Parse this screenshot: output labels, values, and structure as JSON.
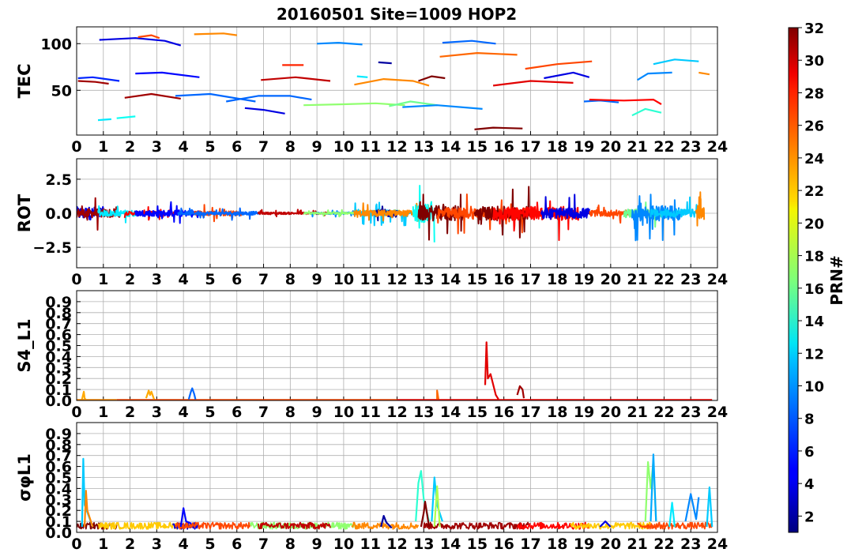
{
  "title": "20160501 Site=1009 HOP2",
  "colorbar": {
    "label": "PRN#",
    "min": 1,
    "max": 32,
    "ticks": [
      2,
      4,
      6,
      8,
      10,
      12,
      14,
      16,
      18,
      20,
      22,
      24,
      26,
      28,
      30,
      32
    ],
    "colormap": "jet"
  },
  "chart_data": [
    {
      "type": "line",
      "ylabel": "TEC",
      "xlim": [
        0,
        24
      ],
      "ylim": [
        2,
        118
      ],
      "xticks": [
        0,
        1,
        2,
        3,
        4,
        5,
        6,
        7,
        8,
        9,
        10,
        11,
        12,
        13,
        14,
        15,
        16,
        17,
        18,
        19,
        20,
        21,
        22,
        23,
        24
      ],
      "yticks": [
        50,
        100
      ],
      "ytick_labels": [
        "50",
        "100"
      ],
      "grid": true,
      "series": [
        {
          "prn": 6,
          "x": [
            0.05,
            0.6,
            1.6
          ],
          "y": [
            63,
            64,
            60
          ]
        },
        {
          "prn": 31,
          "x": [
            0.05,
            0.7,
            1.2
          ],
          "y": [
            60,
            59,
            57
          ]
        },
        {
          "prn": 12,
          "x": [
            0.8,
            1.3
          ],
          "y": [
            18,
            19
          ]
        },
        {
          "prn": 13,
          "x": [
            1.5,
            2.2
          ],
          "y": [
            20,
            22
          ]
        },
        {
          "prn": 4,
          "x": [
            0.85,
            2.2,
            3.3,
            3.9
          ],
          "y": [
            104,
            106,
            103,
            98
          ]
        },
        {
          "prn": 26,
          "x": [
            2.3,
            2.8,
            3.1
          ],
          "y": [
            107,
            109,
            106
          ]
        },
        {
          "prn": 5,
          "x": [
            2.2,
            3.2,
            4.6
          ],
          "y": [
            68,
            69,
            64
          ]
        },
        {
          "prn": 31,
          "x": [
            1.8,
            2.8,
            3.9
          ],
          "y": [
            42,
            46,
            41
          ]
        },
        {
          "prn": 24,
          "x": [
            4.4,
            5.5,
            6.0
          ],
          "y": [
            110,
            111,
            109
          ]
        },
        {
          "prn": 8,
          "x": [
            3.7,
            5.0,
            6.7
          ],
          "y": [
            44,
            46,
            38
          ]
        },
        {
          "prn": 8,
          "x": [
            5.6,
            6.8,
            8.0,
            8.8
          ],
          "y": [
            38,
            44,
            44,
            40
          ]
        },
        {
          "prn": 4,
          "x": [
            6.3,
            7.0,
            7.8
          ],
          "y": [
            31,
            29,
            25
          ]
        },
        {
          "prn": 30,
          "x": [
            6.9,
            8.2,
            9.5
          ],
          "y": [
            61,
            64,
            60
          ]
        },
        {
          "prn": 27,
          "x": [
            7.7,
            8.5
          ],
          "y": [
            77,
            77
          ]
        },
        {
          "prn": 9,
          "x": [
            9.0,
            9.8,
            10.7
          ],
          "y": [
            100,
            101,
            99
          ]
        },
        {
          "prn": 17,
          "x": [
            8.5,
            10.0,
            11.2,
            12.3
          ],
          "y": [
            34,
            35,
            36,
            34
          ]
        },
        {
          "prn": 16,
          "x": [
            11.7,
            12.5,
            13.5
          ],
          "y": [
            33,
            38,
            34
          ]
        },
        {
          "prn": 12,
          "x": [
            10.5,
            10.9
          ],
          "y": [
            65,
            64
          ]
        },
        {
          "prn": 2,
          "x": [
            11.3,
            11.8
          ],
          "y": [
            80,
            79
          ]
        },
        {
          "prn": 24,
          "x": [
            10.4,
            11.5,
            12.6,
            13.2
          ],
          "y": [
            56,
            62,
            60,
            55
          ]
        },
        {
          "prn": 32,
          "x": [
            12.8,
            13.3,
            13.8
          ],
          "y": [
            60,
            65,
            63
          ]
        },
        {
          "prn": 9,
          "x": [
            12.2,
            13.5,
            15.2
          ],
          "y": [
            32,
            34,
            30
          ]
        },
        {
          "prn": 8,
          "x": [
            13.7,
            14.8,
            15.7
          ],
          "y": [
            101,
            103,
            100
          ]
        },
        {
          "prn": 25,
          "x": [
            13.6,
            15.0,
            16.5
          ],
          "y": [
            86,
            90,
            88
          ]
        },
        {
          "prn": 32,
          "x": [
            14.9,
            15.6,
            16.7
          ],
          "y": [
            8,
            10,
            9
          ]
        },
        {
          "prn": 29,
          "x": [
            15.6,
            17.0,
            18.6
          ],
          "y": [
            55,
            60,
            58
          ]
        },
        {
          "prn": 4,
          "x": [
            17.5,
            18.6,
            19.2
          ],
          "y": [
            63,
            69,
            64
          ]
        },
        {
          "prn": 26,
          "x": [
            16.8,
            18.0,
            19.3
          ],
          "y": [
            73,
            78,
            81
          ]
        },
        {
          "prn": 8,
          "x": [
            19.0,
            19.6,
            20.3
          ],
          "y": [
            38,
            39,
            37
          ]
        },
        {
          "prn": 28,
          "x": [
            19.2,
            20.5,
            21.6,
            21.9
          ],
          "y": [
            40,
            39,
            40,
            35
          ]
        },
        {
          "prn": 14,
          "x": [
            20.8,
            21.3,
            21.9
          ],
          "y": [
            23,
            30,
            26
          ]
        },
        {
          "prn": 9,
          "x": [
            21.0,
            21.4,
            22.3
          ],
          "y": [
            61,
            68,
            69
          ]
        },
        {
          "prn": 11,
          "x": [
            21.6,
            22.4,
            23.3
          ],
          "y": [
            78,
            83,
            81
          ]
        },
        {
          "prn": 24,
          "x": [
            23.3,
            23.7
          ],
          "y": [
            69,
            67
          ]
        }
      ]
    },
    {
      "type": "line",
      "ylabel": "ROT",
      "xlim": [
        0,
        24
      ],
      "ylim": [
        -4,
        4
      ],
      "xticks": [
        0,
        1,
        2,
        3,
        4,
        5,
        6,
        7,
        8,
        9,
        10,
        11,
        12,
        13,
        14,
        15,
        16,
        17,
        18,
        19,
        20,
        21,
        22,
        23,
        24
      ],
      "yticks": [
        -2.5,
        0.0,
        2.5
      ],
      "ytick_labels": [
        "−2.5",
        "0.0",
        "2.5"
      ],
      "grid": true,
      "segments": [
        {
          "prn": 4,
          "start": 0.0,
          "end": 1.0,
          "amp": 1.9
        },
        {
          "prn": 31,
          "start": 0.0,
          "end": 1.6,
          "amp": 1.3
        },
        {
          "prn": 12,
          "start": 0.8,
          "end": 2.2,
          "amp": 0.9
        },
        {
          "prn": 28,
          "start": 1.8,
          "end": 3.9,
          "amp": 0.5
        },
        {
          "prn": 5,
          "start": 2.2,
          "end": 4.6,
          "amp": 0.9
        },
        {
          "prn": 26,
          "start": 4.4,
          "end": 6.2,
          "amp": 0.7
        },
        {
          "prn": 8,
          "start": 3.8,
          "end": 6.8,
          "amp": 0.5
        },
        {
          "prn": 30,
          "start": 6.8,
          "end": 9.5,
          "amp": 0.3
        },
        {
          "prn": 9,
          "start": 8.8,
          "end": 10.7,
          "amp": 0.3
        },
        {
          "prn": 17,
          "start": 8.5,
          "end": 12.2,
          "amp": 0.25
        },
        {
          "prn": 11,
          "start": 10.4,
          "end": 12.5,
          "amp": 0.9
        },
        {
          "prn": 2,
          "start": 11.2,
          "end": 12.0,
          "amp": 1.1
        },
        {
          "prn": 24,
          "start": 10.4,
          "end": 13.2,
          "amp": 0.9
        },
        {
          "prn": 13,
          "start": 12.6,
          "end": 13.4,
          "amp": 2.8
        },
        {
          "prn": 32,
          "start": 12.8,
          "end": 14.5,
          "amp": 2.2
        },
        {
          "prn": 26,
          "start": 13.5,
          "end": 16.8,
          "amp": 1.6
        },
        {
          "prn": 32,
          "start": 14.9,
          "end": 17.0,
          "amp": 2.0
        },
        {
          "prn": 28,
          "start": 15.6,
          "end": 18.8,
          "amp": 2.0
        },
        {
          "prn": 4,
          "start": 17.4,
          "end": 19.2,
          "amp": 1.5
        },
        {
          "prn": 26,
          "start": 19.2,
          "end": 21.8,
          "amp": 0.9
        },
        {
          "prn": 16,
          "start": 20.5,
          "end": 22.0,
          "amp": 1.3
        },
        {
          "prn": 9,
          "start": 20.8,
          "end": 22.6,
          "amp": 2.2
        },
        {
          "prn": 11,
          "start": 21.5,
          "end": 23.3,
          "amp": 1.2
        },
        {
          "prn": 24,
          "start": 23.2,
          "end": 23.5,
          "amp": 1.6
        }
      ]
    },
    {
      "type": "line",
      "ylabel": "S4_L1",
      "xlim": [
        0,
        24
      ],
      "ylim": [
        0,
        1
      ],
      "xticks": [
        0,
        1,
        2,
        3,
        4,
        5,
        6,
        7,
        8,
        9,
        10,
        11,
        12,
        13,
        14,
        15,
        16,
        17,
        18,
        19,
        20,
        21,
        22,
        23,
        24
      ],
      "yticks": [
        0.0,
        0.1,
        0.2,
        0.3,
        0.4,
        0.5,
        0.6,
        0.7,
        0.8,
        0.9
      ],
      "ytick_labels": [
        "0.0",
        "0.1",
        "0.2",
        "0.3",
        "0.4",
        "0.5",
        "0.6",
        "0.7",
        "0.8",
        "0.9"
      ],
      "grid": true,
      "baseline_series": [
        {
          "prn": 24,
          "start": 0.0,
          "end": 1.5
        },
        {
          "prn": 26,
          "start": 1.5,
          "end": 12.0
        },
        {
          "prn": 28,
          "start": 12.0,
          "end": 23.8
        }
      ],
      "series": [
        {
          "prn": 23,
          "x": [
            0.2,
            0.27,
            0.3,
            0.33
          ],
          "y": [
            0.01,
            0.08,
            0.02,
            0.01
          ]
        },
        {
          "prn": 23,
          "x": [
            2.6,
            2.7,
            2.75,
            2.8,
            2.9
          ],
          "y": [
            0.02,
            0.09,
            0.05,
            0.08,
            0.01
          ]
        },
        {
          "prn": 8,
          "x": [
            4.2,
            4.28,
            4.33,
            4.4,
            4.45
          ],
          "y": [
            0.01,
            0.08,
            0.11,
            0.06,
            0.01
          ]
        },
        {
          "prn": 25,
          "x": [
            13.5,
            13.5,
            13.55
          ],
          "y": [
            0.01,
            0.09,
            0.01
          ]
        },
        {
          "prn": 29,
          "x": [
            15.3,
            15.35,
            15.4,
            15.5,
            15.7,
            15.8
          ],
          "y": [
            0.14,
            0.53,
            0.2,
            0.24,
            0.05,
            0.01
          ]
        },
        {
          "prn": 31,
          "x": [
            16.5,
            16.6,
            16.7,
            16.75
          ],
          "y": [
            0.05,
            0.13,
            0.1,
            0.02
          ]
        }
      ]
    },
    {
      "type": "line",
      "ylabel": "σφL1",
      "xlim": [
        0,
        24
      ],
      "ylim": [
        0,
        1
      ],
      "xticks": [
        0,
        1,
        2,
        3,
        4,
        5,
        6,
        7,
        8,
        9,
        10,
        11,
        12,
        13,
        14,
        15,
        16,
        17,
        18,
        19,
        20,
        21,
        22,
        23,
        24
      ],
      "yticks": [
        0.0,
        0.1,
        0.2,
        0.3,
        0.4,
        0.5,
        0.6,
        0.7,
        0.8,
        0.9
      ],
      "ytick_labels": [
        "0.0",
        "0.1",
        "0.2",
        "0.3",
        "0.4",
        "0.5",
        "0.6",
        "0.7",
        "0.8",
        "0.9"
      ],
      "grid": true,
      "baseline_segments": [
        {
          "prn": 32,
          "start": 0.0,
          "end": 1.5
        },
        {
          "prn": 22,
          "start": 0.8,
          "end": 3.8
        },
        {
          "prn": 4,
          "start": 3.6,
          "end": 4.6
        },
        {
          "prn": 26,
          "start": 3.7,
          "end": 6.5
        },
        {
          "prn": 17,
          "start": 6.5,
          "end": 10.5
        },
        {
          "prn": 30,
          "start": 6.8,
          "end": 9.5
        },
        {
          "prn": 24,
          "start": 10.3,
          "end": 12.8
        },
        {
          "prn": 31,
          "start": 13.0,
          "end": 17.0
        },
        {
          "prn": 28,
          "start": 16.5,
          "end": 19.2
        },
        {
          "prn": 22,
          "start": 18.5,
          "end": 21.5
        },
        {
          "prn": 26,
          "start": 21.0,
          "end": 23.8
        }
      ],
      "series": [
        {
          "prn": 11,
          "x": [
            0.2,
            0.25,
            0.3,
            0.45,
            0.6
          ],
          "y": [
            0.05,
            0.67,
            0.25,
            0.15,
            0.05
          ]
        },
        {
          "prn": 24,
          "x": [
            0.3,
            0.35,
            0.4,
            0.6
          ],
          "y": [
            0.05,
            0.38,
            0.2,
            0.05
          ]
        },
        {
          "prn": 5,
          "x": [
            3.9,
            4.0,
            4.1,
            4.3
          ],
          "y": [
            0.05,
            0.22,
            0.1,
            0.08
          ]
        },
        {
          "prn": 2,
          "x": [
            11.4,
            11.5,
            11.6,
            11.8
          ],
          "y": [
            0.05,
            0.15,
            0.09,
            0.04
          ]
        },
        {
          "prn": 14,
          "x": [
            12.7,
            12.8,
            12.9,
            13.0,
            13.2
          ],
          "y": [
            0.1,
            0.45,
            0.56,
            0.3,
            0.1
          ]
        },
        {
          "prn": 32,
          "x": [
            12.9,
            13.0,
            13.05,
            13.2
          ],
          "y": [
            0.05,
            0.18,
            0.28,
            0.05
          ]
        },
        {
          "prn": 11,
          "x": [
            13.3,
            13.4,
            13.5,
            13.7
          ],
          "y": [
            0.1,
            0.5,
            0.25,
            0.1
          ]
        },
        {
          "prn": 18,
          "x": [
            13.4,
            13.5,
            13.6
          ],
          "y": [
            0.05,
            0.42,
            0.05
          ]
        },
        {
          "prn": 4,
          "x": [
            19.6,
            19.8,
            20.0
          ],
          "y": [
            0.05,
            0.1,
            0.05
          ]
        },
        {
          "prn": 17,
          "x": [
            21.3,
            21.4,
            21.5,
            21.6,
            21.7
          ],
          "y": [
            0.1,
            0.64,
            0.4,
            0.65,
            0.1
          ]
        },
        {
          "prn": 10,
          "x": [
            21.5,
            21.6,
            21.7
          ],
          "y": [
            0.1,
            0.71,
            0.1
          ]
        },
        {
          "prn": 12,
          "x": [
            22.2,
            22.3,
            22.4
          ],
          "y": [
            0.05,
            0.27,
            0.05
          ]
        },
        {
          "prn": 9,
          "x": [
            22.8,
            23.0,
            23.2,
            23.3
          ],
          "y": [
            0.1,
            0.35,
            0.12,
            0.32
          ]
        },
        {
          "prn": 11,
          "x": [
            23.6,
            23.7,
            23.8
          ],
          "y": [
            0.05,
            0.41,
            0.05
          ]
        }
      ]
    }
  ]
}
